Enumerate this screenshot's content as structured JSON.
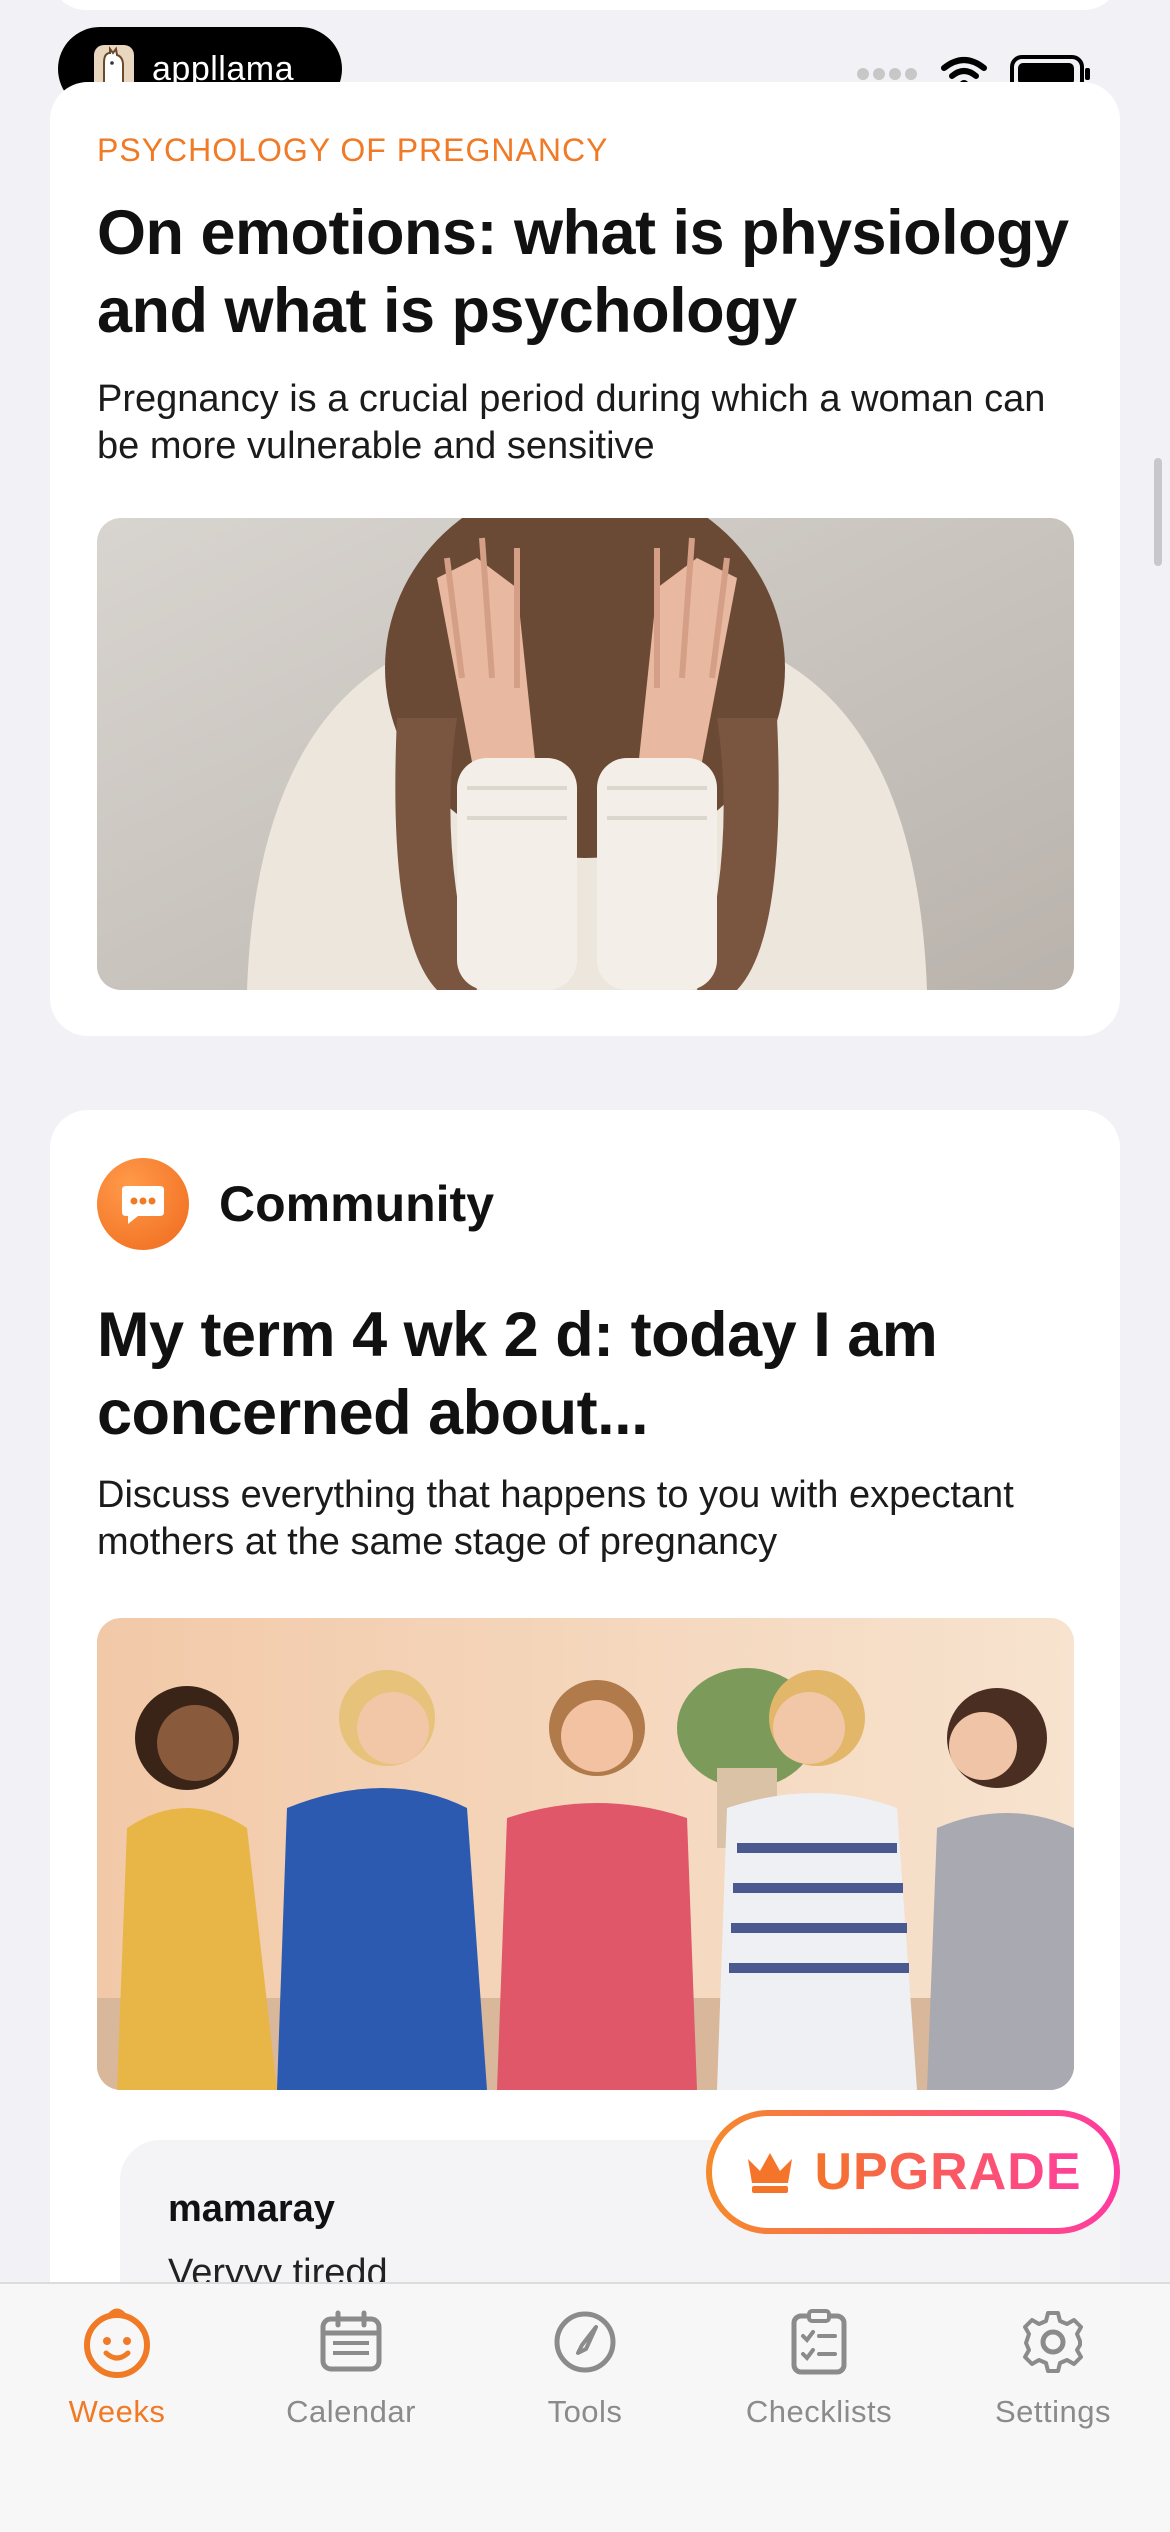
{
  "status": {
    "app_name": "appllama"
  },
  "article": {
    "category": "PSYCHOLOGY OF PREGNANCY",
    "title": "On emotions: what is physiology and what is psychology",
    "description": "Pregnancy is a crucial period during which a woman can be more vulnerable and sensitive"
  },
  "community": {
    "label": "Community",
    "title": "My term 4 wk 2 d: today I am concerned about...",
    "description": "Discuss everything that happens to you with expectant mothers at the same stage of pregnancy",
    "comment": {
      "author": "mamaray",
      "text": "Veryyy tiredd"
    }
  },
  "upgrade": {
    "label": "UPGRADE"
  },
  "tabs": [
    {
      "label": "Weeks",
      "icon": "baby-face-icon",
      "active": true
    },
    {
      "label": "Calendar",
      "icon": "calendar-icon",
      "active": false
    },
    {
      "label": "Tools",
      "icon": "tools-icon",
      "active": false
    },
    {
      "label": "Checklists",
      "icon": "checklist-icon",
      "active": false
    },
    {
      "label": "Settings",
      "icon": "gear-icon",
      "active": false
    }
  ],
  "colors": {
    "accent": "#f07a25",
    "upgrade_gradient_start": "#f58a2a",
    "upgrade_gradient_end": "#ff3aa0"
  }
}
